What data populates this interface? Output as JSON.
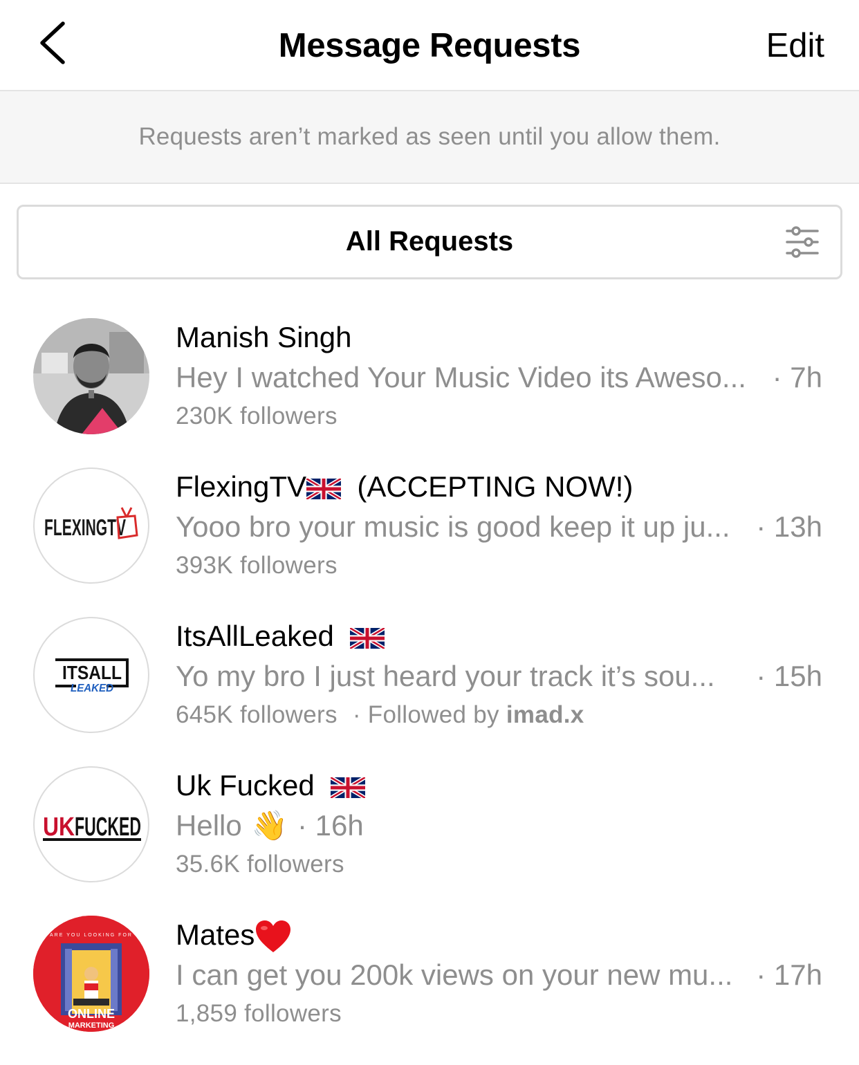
{
  "header": {
    "title": "Message Requests",
    "edit_label": "Edit",
    "back_icon": "chevron-left-icon"
  },
  "notice": "Requests aren’t marked as seen until you allow them.",
  "filter": {
    "label": "All Requests",
    "icon": "sliders-icon"
  },
  "requests": [
    {
      "name": "Manish Singh",
      "message": "Hey I watched Your Music Video its Aweso...",
      "time": "· 7h",
      "followers": "230K followers"
    },
    {
      "name": "FlexingTV",
      "name_suffix": "(ACCEPTING NOW!)",
      "avatar_text": "FLEXINGTV",
      "message": "Yooo bro your music is good keep it up ju...",
      "time": "· 13h",
      "followers": "393K followers"
    },
    {
      "name": "ItsAllLeaked",
      "avatar_text_top": "ITSALL",
      "avatar_text_bottom": "LEAKED",
      "message": "Yo my bro I just heard your track it’s sou...",
      "time": "· 15h",
      "followers": "645K followers",
      "followed_by_prefix": "·  Followed by",
      "followed_by_user": "imad.x"
    },
    {
      "name": "Uk Fucked",
      "avatar_text_uk": "UK",
      "avatar_text_rest": "FUCKED",
      "message": "Hello",
      "emoji": "👋",
      "time": "· 16h",
      "followers": "35.6K followers"
    },
    {
      "name": "Mates",
      "avatar_text_top": "ARE YOU LOOKING FOR",
      "avatar_text_main": "ONLINE",
      "avatar_text_sub": "MARKETING",
      "message": "I can get you 200k views on your new mu...",
      "time": "· 17h",
      "followers": "1,859 followers"
    }
  ],
  "colors": {
    "secondary_text": "#8e8e8e",
    "divider": "#dbdbdb",
    "notice_bg": "#f6f6f6",
    "mates_avatar_bg": "#e0202a",
    "ukfucked_red": "#c8102e"
  }
}
